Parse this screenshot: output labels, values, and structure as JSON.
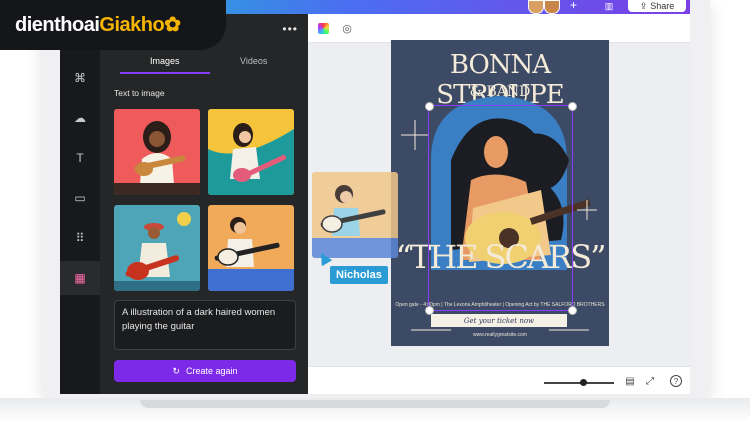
{
  "brand": {
    "logo_main": "dienthoai",
    "logo_accent": "Giakho",
    "accent_color": "#f5b400"
  },
  "topbar": {
    "share_label": "Share",
    "gradient_colors": [
      "#19bfd0",
      "#4a6ff0",
      "#7b3fe6"
    ]
  },
  "rail": {
    "icons": [
      "elements-icon",
      "upload-icon",
      "text-icon",
      "folder-icon",
      "apps-icon",
      "magic-media-icon"
    ]
  },
  "panel": {
    "tabs": [
      "Images",
      "Videos"
    ],
    "active_tab": "Images",
    "section_title": "Text to image",
    "prompt_text": "A illustration of a dark haired women playing the guitar",
    "create_button_label": "Create again",
    "accent_color": "#8b3dff"
  },
  "poster": {
    "title_line1": "BONNA STROUPE",
    "title_line2": "& BAND",
    "headline": "“THE SCARS”",
    "info_line": "Open gate - 4:00pm | The Lexoria Amphitheater | Opening Act by THE SALFORD BROTHERS",
    "ticket_text": "Get your ticket now",
    "website": "www.reallygreatsite.com",
    "background_color": "#3d4a66"
  },
  "collaborator": {
    "name": "Nicholas",
    "color": "#2a9bd4"
  }
}
